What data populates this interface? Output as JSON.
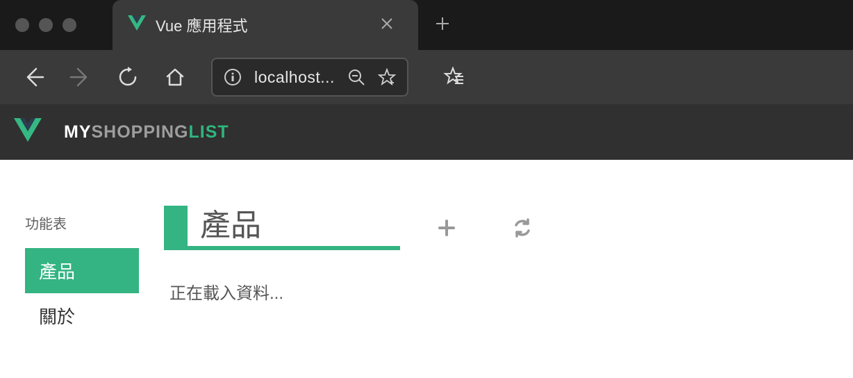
{
  "browser": {
    "tab_title": "Vue 應用程式",
    "address": "localhost..."
  },
  "header": {
    "brand_my": "MY",
    "brand_shopping": "SHOPPING",
    "brand_list": "LIST"
  },
  "sidebar": {
    "title": "功能表",
    "items": [
      {
        "label": "產品",
        "active": true
      },
      {
        "label": "關於",
        "active": false
      }
    ]
  },
  "content": {
    "page_title": "產品",
    "loading_text": "正在載入資料..."
  }
}
